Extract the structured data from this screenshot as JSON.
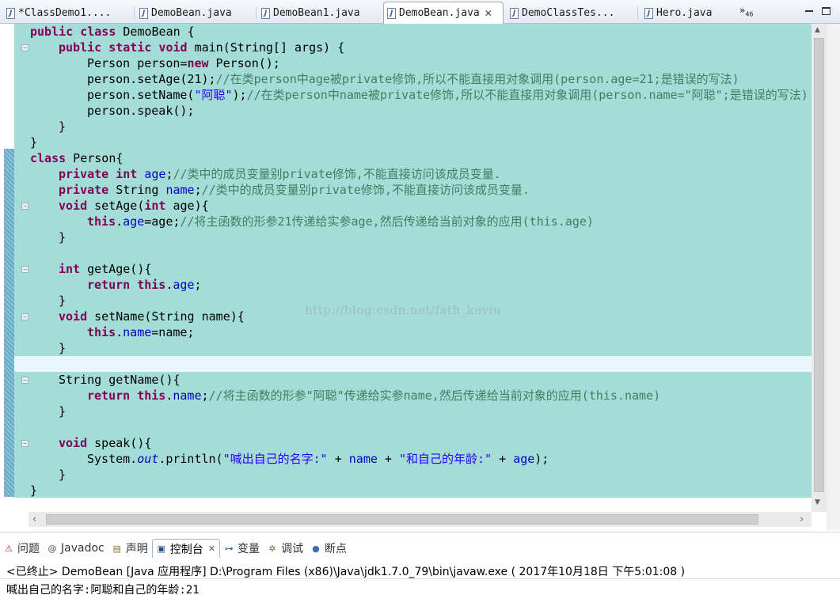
{
  "tabs": [
    {
      "label": "*ClassDemo1....",
      "active": false
    },
    {
      "label": "DemoBean.java",
      "active": false
    },
    {
      "label": "DemoBean1.java",
      "active": false
    },
    {
      "label": "DemoBean.java",
      "active": true,
      "close": "✕"
    },
    {
      "label": "DemoClassTes...",
      "active": false
    },
    {
      "label": "Hero.java",
      "active": false
    }
  ],
  "tab_overflow": {
    "chevron": "»",
    "count": "46"
  },
  "code": {
    "l1": {
      "a": "public class",
      "b": " DemoBean {"
    },
    "l2": {
      "a": "public static void",
      "b": " main(String[] args) {"
    },
    "l3": {
      "a": "Person person=",
      "b": "new",
      "c": " Person();"
    },
    "l4": {
      "a": "person.setAge(21);",
      "b": "//在类person中age被private修饰,所以不能直接用对象调用(person.age=21;是错误的写法)"
    },
    "l5": {
      "a": "person.setName(",
      "b": "\"阿聪\"",
      "c": ");",
      "d": "//在类person中name被private修饰,所以不能直接用对象调用(person.name=\"阿聪\";是错误的写法)"
    },
    "l6": {
      "a": "person.speak();"
    },
    "l7": {
      "a": "}"
    },
    "l8": {
      "a": "}"
    },
    "l9": {
      "a": "class",
      "b": " Person{"
    },
    "l10": {
      "a": "private int",
      "b": " ",
      "c": "age",
      "d": ";",
      "e": "//类中的成员变量别private修饰,不能直接访问该成员变量."
    },
    "l11": {
      "a": "private",
      "b": " String ",
      "c": "name",
      "d": ";",
      "e": "//类中的成员变量别private修饰,不能直接访问该成员变量."
    },
    "l12": {
      "a": "void",
      "b": " setAge(",
      "c": "int",
      "d": " age){"
    },
    "l13": {
      "a": "this",
      "b": ".",
      "c": "age",
      "d": "=age;",
      "e": "//将主函数的形参21传递给实参age,然后传递给当前对象的应用(this.age)"
    },
    "l14": {
      "a": "}"
    },
    "l16": {
      "a": "int",
      "b": " getAge(){"
    },
    "l17": {
      "a": "return this",
      "b": ".",
      "c": "age",
      "d": ";"
    },
    "l18": {
      "a": "}"
    },
    "l19": {
      "a": "void",
      "b": " setName(String name){"
    },
    "l20": {
      "a": "this",
      "b": ".",
      "c": "name",
      "d": "=name;"
    },
    "l21": {
      "a": "}"
    },
    "l23": {
      "a": "String getName(){"
    },
    "l24": {
      "a": "return this",
      "b": ".",
      "c": "name",
      "d": ";",
      "e": "//将主函数的形参\"阿聪\"传递给实参name,然后传递给当前对象的应用(this.name)"
    },
    "l25": {
      "a": "}"
    },
    "l27": {
      "a": "void",
      "b": " speak(){"
    },
    "l28": {
      "a": "System.",
      "b": "out",
      "c": ".println(",
      "d": "\"喊出自己的名字:\"",
      "e": " + ",
      "f": "name",
      "g": " + ",
      "h": "\"和自己的年龄:\"",
      "i": " + ",
      "j": "age",
      "k": ");"
    },
    "l29": {
      "a": "}"
    },
    "l30": {
      "a": "}"
    }
  },
  "watermark": "http://blog.csdn.net/fath_kevin",
  "panel_tabs": [
    {
      "label": "问题",
      "icon": "problems-icon"
    },
    {
      "label": "Javadoc",
      "icon": "javadoc-icon"
    },
    {
      "label": "声明",
      "icon": "declaration-icon"
    },
    {
      "label": "控制台",
      "icon": "console-icon",
      "active": true,
      "close": "✕"
    },
    {
      "label": "变量",
      "icon": "variables-icon"
    },
    {
      "label": "调试",
      "icon": "debug-icon"
    },
    {
      "label": "断点",
      "icon": "breakpoints-icon"
    }
  ],
  "console": {
    "terminated": "<已终止>",
    "status": " DemoBean [Java 应用程序] D:\\Program Files (x86)\\Java\\jdk1.7.0_79\\bin\\javaw.exe ( 2017年10月18日 下午5:01:08 )",
    "output": "喊出自己的名字:阿聪和自己的年龄:21"
  },
  "colors": {
    "editor_bg": "#a4dcd8",
    "keyword": "#7f0055",
    "comment": "#3f7f5f",
    "string": "#2a00ff",
    "field": "#0000c0"
  }
}
